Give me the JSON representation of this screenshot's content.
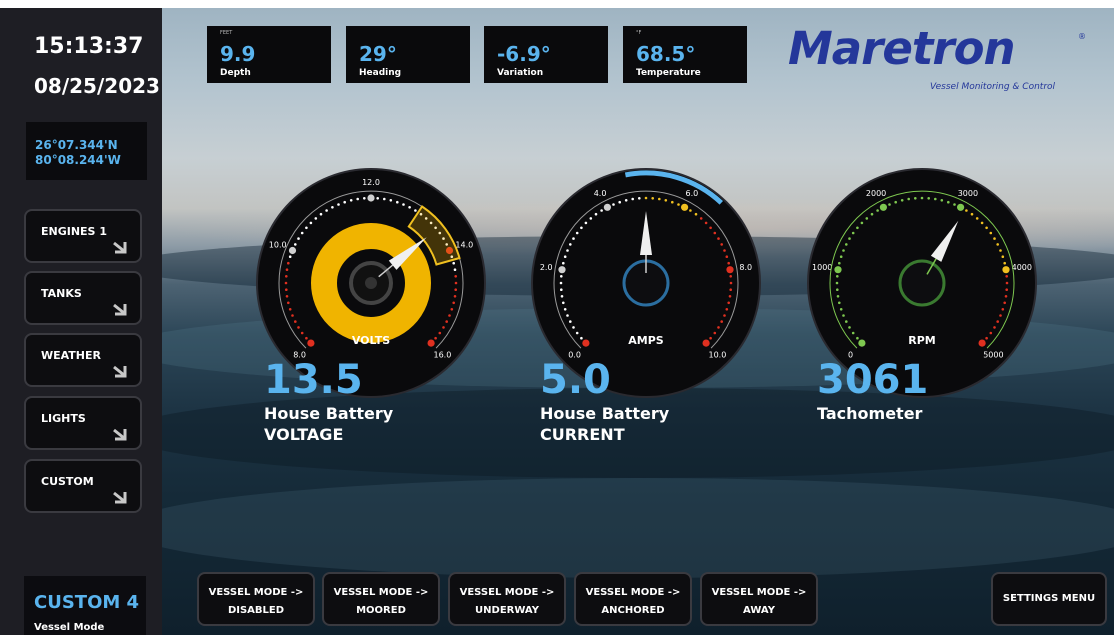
{
  "clock": {
    "time": "15:13:37",
    "date": "08/25/2023"
  },
  "position": {
    "lat": "26°07.344'N",
    "lon": "80°08.244'W"
  },
  "nav": [
    {
      "label": "ENGINES 1"
    },
    {
      "label": "TANKS"
    },
    {
      "label": "WEATHER"
    },
    {
      "label": "LIGHTS"
    },
    {
      "label": "CUSTOM"
    }
  ],
  "vessel_mode": {
    "value": "CUSTOM 4",
    "label": "Vessel Mode"
  },
  "data_boxes": [
    {
      "unit": "FEET",
      "value": "9.9",
      "name": "Depth"
    },
    {
      "unit": "",
      "value": "29°",
      "name": "Heading"
    },
    {
      "unit": "",
      "value": "-6.9°",
      "name": "Variation"
    },
    {
      "unit": "°F",
      "value": "68.5°",
      "name": "Temperature"
    }
  ],
  "logo": {
    "word": "Maretron",
    "reg": "®",
    "tagline": "Vessel Monitoring & Control"
  },
  "gauges": [
    {
      "label": "VOLTS",
      "ticks": [
        "8.0",
        "10.0",
        "12.0",
        "14.0",
        "16.0"
      ],
      "min": 8,
      "max": 16,
      "value": 13.5,
      "reading": "13.5",
      "title1": "House Battery",
      "title2": "VOLTAGE"
    },
    {
      "label": "AMPS",
      "ticks": [
        "0.0",
        "2.0",
        "4.0",
        "6.0",
        "8.0",
        "10.0"
      ],
      "min": 0,
      "max": 10,
      "value": 5.0,
      "reading": "5.0",
      "title1": "House Battery",
      "title2": "CURRENT"
    },
    {
      "label": "RPM",
      "ticks": [
        "0",
        "1000",
        "2000",
        "3000",
        "4000",
        "5000"
      ],
      "min": 0,
      "max": 5000,
      "value": 3061,
      "reading": "3061",
      "title1": "Tachometer",
      "title2": ""
    }
  ],
  "mode_buttons": [
    {
      "line1": "VESSEL MODE ->",
      "line2": "DISABLED"
    },
    {
      "line1": "VESSEL MODE ->",
      "line2": "MOORED"
    },
    {
      "line1": "VESSEL MODE ->",
      "line2": "UNDERWAY"
    },
    {
      "line1": "VESSEL MODE ->",
      "line2": "ANCHORED"
    },
    {
      "line1": "VESSEL MODE ->",
      "line2": "AWAY"
    }
  ],
  "settings_button": "SETTINGS MENU",
  "colors": {
    "accent": "#5ab4ee",
    "brand": "#24379a",
    "volts_fill": "#f0b400",
    "warn": "#e03020",
    "ok": "#7ec850",
    "caution": "#f0c020"
  }
}
